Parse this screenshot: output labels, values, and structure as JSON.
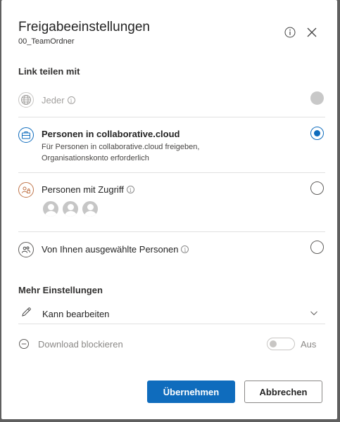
{
  "dialog": {
    "title": "Freigabeeinstellungen",
    "subtitle": "00_TeamOrdner",
    "info_icon": "info-icon",
    "close_icon": "close-icon"
  },
  "link_section": {
    "title": "Link teilen mit",
    "options": [
      {
        "label": "Jeder",
        "icon": "globe-icon",
        "has_info": true,
        "state": "disabled"
      },
      {
        "label": "Personen in collaborative.cloud",
        "description_lines": [
          "Für Personen in collaborative.cloud freigeben,",
          "Organisationskonto erforderlich"
        ],
        "icon": "organization-icon",
        "state": "selected"
      },
      {
        "label": "Personen mit Zugriff",
        "icon": "people-with-access-icon",
        "has_info": true,
        "avatar_count": 3,
        "state": "unselected"
      },
      {
        "label": "Von Ihnen ausgewählte Personen",
        "icon": "specific-people-icon",
        "has_info": true,
        "state": "unselected"
      }
    ]
  },
  "more_settings": {
    "title": "Mehr Einstellungen",
    "permission": {
      "value": "Kann bearbeiten",
      "icon": "pencil-icon"
    },
    "block_download": {
      "label": "Download blockieren",
      "state_label": "Aus",
      "icon": "minus-circle-icon",
      "enabled": false
    }
  },
  "buttons": {
    "apply": "Übernehmen",
    "cancel": "Abbrechen"
  },
  "colors": {
    "accent": "#0f6cbd",
    "disabled": "#c8c8c8",
    "backdrop": "#5f5f5f"
  }
}
